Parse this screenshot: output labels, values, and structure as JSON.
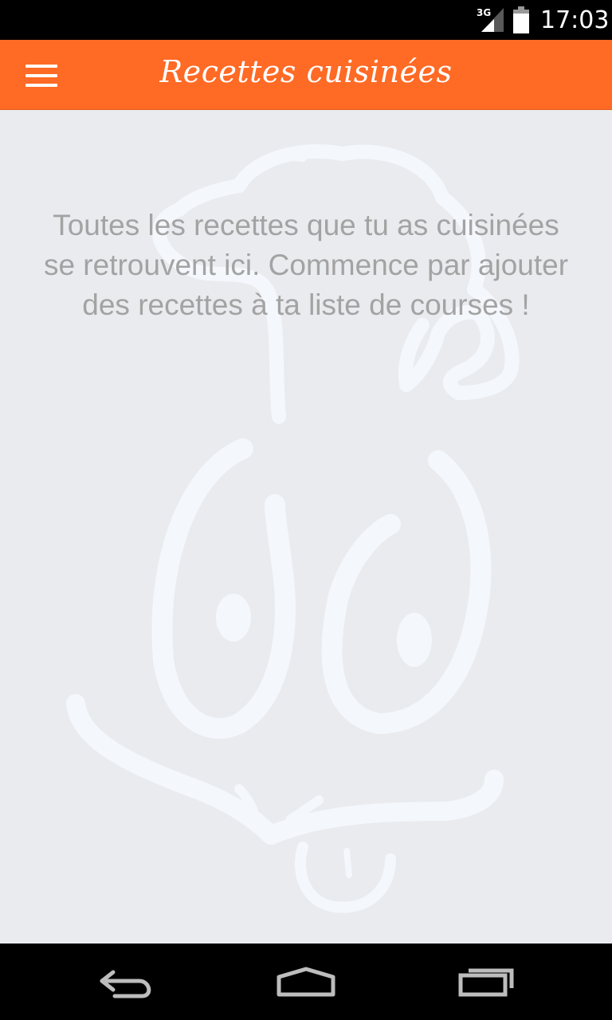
{
  "status_bar": {
    "network_type": "3G",
    "time": "17:03",
    "icons": [
      "signal-icon",
      "battery-icon"
    ]
  },
  "app_bar": {
    "title": "Recettes cuisinées",
    "menu_icon": "hamburger-menu-icon",
    "background_color": "#ff6a25"
  },
  "empty_state": {
    "message": "Toutes les recettes que tu as cuisinées se retrouvent ici. Commence par ajouter des recettes à ta liste de courses !",
    "illustration": "chef-face-illustration"
  },
  "nav_bar": {
    "icons": [
      "back-icon",
      "home-icon",
      "recent-apps-icon"
    ]
  }
}
